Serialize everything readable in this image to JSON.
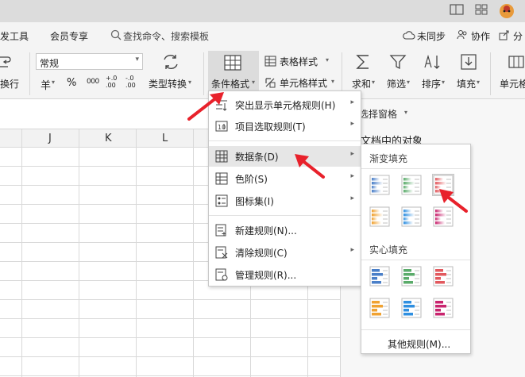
{
  "menubar": {
    "tab_dev": "发工具",
    "tab_vip": "会员专享",
    "search": "查找命令、搜索模板",
    "unsync": "未同步",
    "collab": "协作",
    "share": "分"
  },
  "ribbon": {
    "wrap": "换行",
    "number_format": "常规",
    "yuan": "羊",
    "percent": "%",
    "thousands": "000",
    "dec_inc": "+.0 .00",
    "dec_dec": "-.0 .00",
    "type_convert": "类型转换",
    "cond_format": "条件格式",
    "table_style": "表格样式",
    "cell_style": "单元格样式",
    "sum": "求和",
    "filter": "筛选",
    "sort": "排序",
    "fill": "填充",
    "cell": "单元格"
  },
  "pane": {
    "select_pane": "选择窗格",
    "doc_objects": "文档中的对象"
  },
  "columns": [
    "J",
    "K",
    "L"
  ],
  "menu": {
    "items": [
      {
        "label": "突出显示单元格规则(H)",
        "arrow": "▸"
      },
      {
        "label": "项目选取规则(T)",
        "arrow": "▸"
      },
      {
        "label": "数据条(D)",
        "arrow": "▸"
      },
      {
        "label": "色阶(S)",
        "arrow": "▸"
      },
      {
        "label": "图标集(I)",
        "arrow": "▸"
      },
      {
        "label": "新建规则(N)..."
      },
      {
        "label": "清除规则(C)",
        "arrow": "▸"
      },
      {
        "label": "管理规则(R)..."
      }
    ]
  },
  "submenu": {
    "gradient_title": "渐变填充",
    "solid_title": "实心填充",
    "more_rules": "其他规则(M)..."
  },
  "colors": {
    "blue": "#4a7fc8",
    "green": "#5aab6a",
    "red": "#e2595e",
    "orange": "#f0a232",
    "lightblue": "#2f8fe0",
    "magenta": "#c8246e",
    "arrow_red": "#e8212b"
  }
}
